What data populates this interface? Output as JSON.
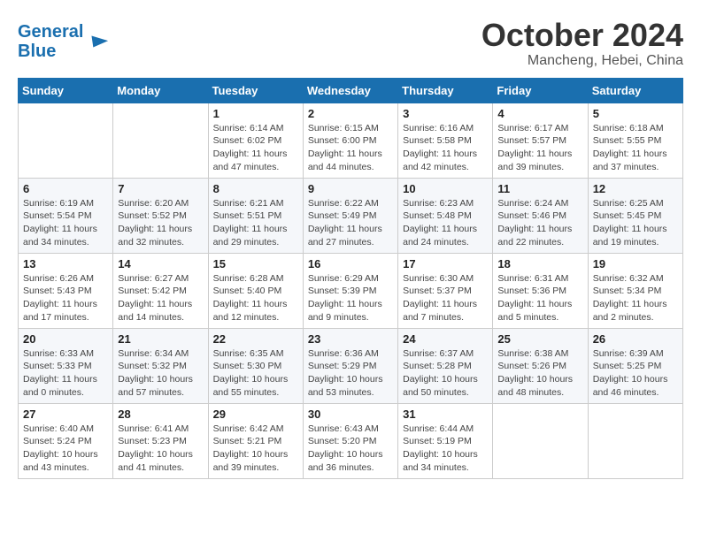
{
  "header": {
    "logo_line1": "General",
    "logo_line2": "Blue",
    "month": "October 2024",
    "location": "Mancheng, Hebei, China"
  },
  "weekdays": [
    "Sunday",
    "Monday",
    "Tuesday",
    "Wednesday",
    "Thursday",
    "Friday",
    "Saturday"
  ],
  "weeks": [
    [
      {
        "day": "",
        "sunrise": "",
        "sunset": "",
        "daylight": ""
      },
      {
        "day": "",
        "sunrise": "",
        "sunset": "",
        "daylight": ""
      },
      {
        "day": "1",
        "sunrise": "Sunrise: 6:14 AM",
        "sunset": "Sunset: 6:02 PM",
        "daylight": "Daylight: 11 hours and 47 minutes."
      },
      {
        "day": "2",
        "sunrise": "Sunrise: 6:15 AM",
        "sunset": "Sunset: 6:00 PM",
        "daylight": "Daylight: 11 hours and 44 minutes."
      },
      {
        "day": "3",
        "sunrise": "Sunrise: 6:16 AM",
        "sunset": "Sunset: 5:58 PM",
        "daylight": "Daylight: 11 hours and 42 minutes."
      },
      {
        "day": "4",
        "sunrise": "Sunrise: 6:17 AM",
        "sunset": "Sunset: 5:57 PM",
        "daylight": "Daylight: 11 hours and 39 minutes."
      },
      {
        "day": "5",
        "sunrise": "Sunrise: 6:18 AM",
        "sunset": "Sunset: 5:55 PM",
        "daylight": "Daylight: 11 hours and 37 minutes."
      }
    ],
    [
      {
        "day": "6",
        "sunrise": "Sunrise: 6:19 AM",
        "sunset": "Sunset: 5:54 PM",
        "daylight": "Daylight: 11 hours and 34 minutes."
      },
      {
        "day": "7",
        "sunrise": "Sunrise: 6:20 AM",
        "sunset": "Sunset: 5:52 PM",
        "daylight": "Daylight: 11 hours and 32 minutes."
      },
      {
        "day": "8",
        "sunrise": "Sunrise: 6:21 AM",
        "sunset": "Sunset: 5:51 PM",
        "daylight": "Daylight: 11 hours and 29 minutes."
      },
      {
        "day": "9",
        "sunrise": "Sunrise: 6:22 AM",
        "sunset": "Sunset: 5:49 PM",
        "daylight": "Daylight: 11 hours and 27 minutes."
      },
      {
        "day": "10",
        "sunrise": "Sunrise: 6:23 AM",
        "sunset": "Sunset: 5:48 PM",
        "daylight": "Daylight: 11 hours and 24 minutes."
      },
      {
        "day": "11",
        "sunrise": "Sunrise: 6:24 AM",
        "sunset": "Sunset: 5:46 PM",
        "daylight": "Daylight: 11 hours and 22 minutes."
      },
      {
        "day": "12",
        "sunrise": "Sunrise: 6:25 AM",
        "sunset": "Sunset: 5:45 PM",
        "daylight": "Daylight: 11 hours and 19 minutes."
      }
    ],
    [
      {
        "day": "13",
        "sunrise": "Sunrise: 6:26 AM",
        "sunset": "Sunset: 5:43 PM",
        "daylight": "Daylight: 11 hours and 17 minutes."
      },
      {
        "day": "14",
        "sunrise": "Sunrise: 6:27 AM",
        "sunset": "Sunset: 5:42 PM",
        "daylight": "Daylight: 11 hours and 14 minutes."
      },
      {
        "day": "15",
        "sunrise": "Sunrise: 6:28 AM",
        "sunset": "Sunset: 5:40 PM",
        "daylight": "Daylight: 11 hours and 12 minutes."
      },
      {
        "day": "16",
        "sunrise": "Sunrise: 6:29 AM",
        "sunset": "Sunset: 5:39 PM",
        "daylight": "Daylight: 11 hours and 9 minutes."
      },
      {
        "day": "17",
        "sunrise": "Sunrise: 6:30 AM",
        "sunset": "Sunset: 5:37 PM",
        "daylight": "Daylight: 11 hours and 7 minutes."
      },
      {
        "day": "18",
        "sunrise": "Sunrise: 6:31 AM",
        "sunset": "Sunset: 5:36 PM",
        "daylight": "Daylight: 11 hours and 5 minutes."
      },
      {
        "day": "19",
        "sunrise": "Sunrise: 6:32 AM",
        "sunset": "Sunset: 5:34 PM",
        "daylight": "Daylight: 11 hours and 2 minutes."
      }
    ],
    [
      {
        "day": "20",
        "sunrise": "Sunrise: 6:33 AM",
        "sunset": "Sunset: 5:33 PM",
        "daylight": "Daylight: 11 hours and 0 minutes."
      },
      {
        "day": "21",
        "sunrise": "Sunrise: 6:34 AM",
        "sunset": "Sunset: 5:32 PM",
        "daylight": "Daylight: 10 hours and 57 minutes."
      },
      {
        "day": "22",
        "sunrise": "Sunrise: 6:35 AM",
        "sunset": "Sunset: 5:30 PM",
        "daylight": "Daylight: 10 hours and 55 minutes."
      },
      {
        "day": "23",
        "sunrise": "Sunrise: 6:36 AM",
        "sunset": "Sunset: 5:29 PM",
        "daylight": "Daylight: 10 hours and 53 minutes."
      },
      {
        "day": "24",
        "sunrise": "Sunrise: 6:37 AM",
        "sunset": "Sunset: 5:28 PM",
        "daylight": "Daylight: 10 hours and 50 minutes."
      },
      {
        "day": "25",
        "sunrise": "Sunrise: 6:38 AM",
        "sunset": "Sunset: 5:26 PM",
        "daylight": "Daylight: 10 hours and 48 minutes."
      },
      {
        "day": "26",
        "sunrise": "Sunrise: 6:39 AM",
        "sunset": "Sunset: 5:25 PM",
        "daylight": "Daylight: 10 hours and 46 minutes."
      }
    ],
    [
      {
        "day": "27",
        "sunrise": "Sunrise: 6:40 AM",
        "sunset": "Sunset: 5:24 PM",
        "daylight": "Daylight: 10 hours and 43 minutes."
      },
      {
        "day": "28",
        "sunrise": "Sunrise: 6:41 AM",
        "sunset": "Sunset: 5:23 PM",
        "daylight": "Daylight: 10 hours and 41 minutes."
      },
      {
        "day": "29",
        "sunrise": "Sunrise: 6:42 AM",
        "sunset": "Sunset: 5:21 PM",
        "daylight": "Daylight: 10 hours and 39 minutes."
      },
      {
        "day": "30",
        "sunrise": "Sunrise: 6:43 AM",
        "sunset": "Sunset: 5:20 PM",
        "daylight": "Daylight: 10 hours and 36 minutes."
      },
      {
        "day": "31",
        "sunrise": "Sunrise: 6:44 AM",
        "sunset": "Sunset: 5:19 PM",
        "daylight": "Daylight: 10 hours and 34 minutes."
      },
      {
        "day": "",
        "sunrise": "",
        "sunset": "",
        "daylight": ""
      },
      {
        "day": "",
        "sunrise": "",
        "sunset": "",
        "daylight": ""
      }
    ]
  ]
}
